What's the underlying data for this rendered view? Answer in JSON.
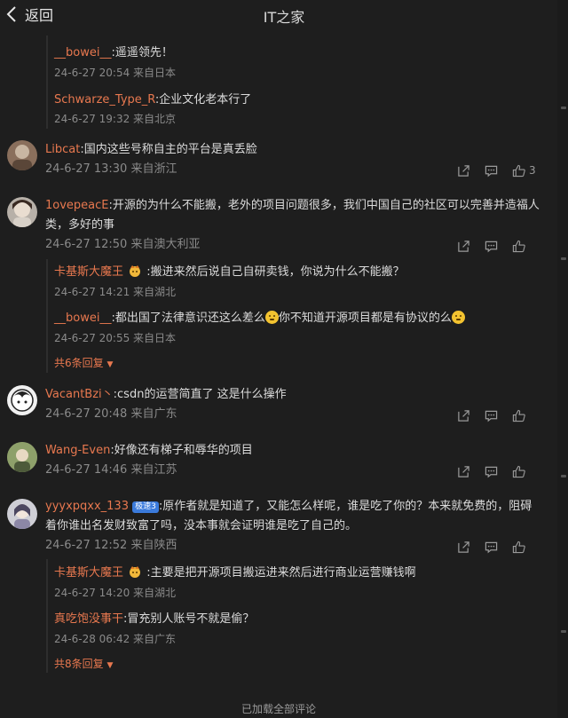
{
  "header": {
    "back_label": "返回",
    "title": "IT之家"
  },
  "top_replies": [
    {
      "name": "__bowei__",
      "text": ":遥遥领先！",
      "meta": "24-6-27 20:54 来自日本"
    },
    {
      "name": "Schwarze_Type_R",
      "text": ":企业文化老本行了",
      "meta": "24-6-27 19:32 来自北京"
    }
  ],
  "comments": [
    {
      "name": "Libcat",
      "text": ":国内这些号称自主的平台是真丢脸",
      "meta": "24-6-27 13:30 来自浙江",
      "likes": "3"
    },
    {
      "name": "1ovepeacE",
      "text": ":开源的为什么不能搬，老外的项目问题很多，我们中国自己的社区可以完善并造福人",
      "text2": "类，多好的事",
      "meta": "24-6-27 12:50 来自澳大利亚",
      "replies": [
        {
          "name": "卡基斯大魔王",
          "text": ":搬进来然后说自己自研卖钱，你说为什么不能搬？",
          "meta": "24-6-27 14:21 来自湖北"
        },
        {
          "name": "__bowei__",
          "text": ":都出国了法律意识还这么差么",
          "text_b": "你不知道开源项目都是有协议的么",
          "meta": "24-6-27 20:55 来自日本"
        }
      ],
      "more": "共6条回复"
    },
    {
      "name": "VacantBzi丶",
      "text": ":csdn的运营简直了 这是什么操作",
      "meta": "24-6-27 20:48 来自广东"
    },
    {
      "name": "Wang-Even",
      "text": ":好像还有梯子和辱华的项目",
      "meta": "24-6-27 14:46 来自江苏"
    },
    {
      "name": "yyyxpqxx_133",
      "badge": "极速3",
      "text": ":原作者就是知道了，又能怎么样呢，谁是吃了你的？本来就免费的，阻碍",
      "text2": "着你谁出名发财致富了吗，没本事就会证明谁是吃了自己的。",
      "meta": "24-6-27 12:52 来自陕西",
      "replies": [
        {
          "name": "卡基斯大魔王",
          "text": ":主要是把开源项目搬运进来然后进行商业运营赚钱啊",
          "meta": "24-6-27 14:20 来自湖北"
        },
        {
          "name": "真吃饱没事干",
          "text": ":冒充别人账号不就是偷？",
          "meta": "24-6-28 06:42 来自广东"
        }
      ],
      "more": "共8条回复"
    }
  ],
  "footer": "已加载全部评论",
  "colors": {
    "background": "#1e1e1e",
    "username": "#e8784f",
    "meta": "#8a8a8a"
  }
}
